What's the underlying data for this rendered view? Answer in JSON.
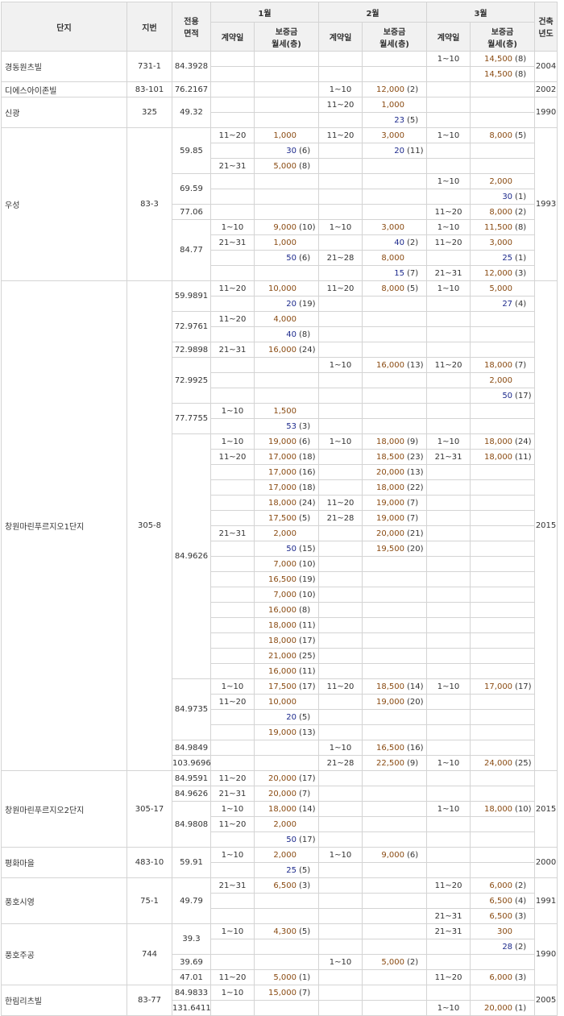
{
  "headers": {
    "complex": "단지",
    "lot": "지번",
    "area": "전용\n면적",
    "months": [
      "1월",
      "2월",
      "3월"
    ],
    "contract_day": "계약일",
    "deposit_rent": "보증금\n월세(층)",
    "built_year": "건축\n년도"
  },
  "rows": [
    {
      "name": "경동원츠빌",
      "lot": "731-1",
      "area": "84.3928",
      "m3d": "1~10",
      "m3a": "14,500",
      "m3f": "(8)",
      "year": "2004"
    },
    {
      "m3a": "14,500",
      "m3f": "(8)"
    },
    {
      "name": "디에스아이존빌",
      "lot": "83-101",
      "area": "76.2167",
      "m2d": "1~10",
      "m2a": "12,000",
      "m2f": "(2)",
      "year": "2002"
    },
    {
      "name": "신광",
      "lot": "325",
      "area": "49.32",
      "m2d": "11~20",
      "m2a": "1,000",
      "year": "1990"
    },
    {
      "m2r": "23",
      "m2f": "(5)"
    },
    {
      "name": "우성",
      "lot": "83-3",
      "area": "59.85",
      "m1d": "11~20",
      "m1a": "1,000",
      "m2d": "11~20",
      "m2a": "3,000",
      "m3d": "1~10",
      "m3a": "8,000",
      "m3f": "(5)",
      "year": "1993"
    },
    {
      "m1r": "30",
      "m1f": "(6)",
      "m2r": "20",
      "m2f": "(11)"
    },
    {
      "m1d": "21~31",
      "m1a": "5,000",
      "m1f": "(8)"
    },
    {
      "area": "69.59",
      "m3d": "1~10",
      "m3a": "2,000"
    },
    {
      "m3r": "30",
      "m3f": "(1)"
    },
    {
      "area": "77.06",
      "m3d": "11~20",
      "m3a": "8,000",
      "m3f": "(2)"
    },
    {
      "area": "84.77",
      "m1d": "1~10",
      "m1a": "9,000",
      "m1f": "(10)",
      "m2d": "1~10",
      "m2a": "3,000",
      "m3d": "1~10",
      "m3a": "11,500",
      "m3f": "(8)"
    },
    {
      "m1d": "21~31",
      "m1a": "1,000",
      "m2r": "40",
      "m2f": "(2)",
      "m3d": "11~20",
      "m3a": "3,000"
    },
    {
      "m1r": "50",
      "m1f": "(6)",
      "m2d": "21~28",
      "m2a": "8,000",
      "m3r": "25",
      "m3f": "(1)"
    },
    {
      "m2r": "15",
      "m2f": "(7)",
      "m3d": "21~31",
      "m3a": "12,000",
      "m3f": "(3)"
    },
    {
      "name": "창원마린푸르지오1단지",
      "lot": "305-8",
      "area": "59.9891",
      "m1d": "11~20",
      "m1a": "10,000",
      "m2d": "11~20",
      "m2a": "8,000",
      "m2f": "(5)",
      "m3d": "1~10",
      "m3a": "5,000",
      "year": "2015"
    },
    {
      "m1r": "20",
      "m1f": "(19)",
      "m3r": "27",
      "m3f": "(4)"
    },
    {
      "area": "72.9761",
      "m1d": "11~20",
      "m1a": "4,000"
    },
    {
      "m1r": "40",
      "m1f": "(8)"
    },
    {
      "area": "72.9898",
      "m1d": "21~31",
      "m1a": "16,000",
      "m1f": "(24)"
    },
    {
      "area": "72.9925",
      "m2d": "1~10",
      "m2a": "16,000",
      "m2f": "(13)",
      "m3d": "11~20",
      "m3a": "18,000",
      "m3f": "(7)"
    },
    {
      "m3a": "2,000"
    },
    {
      "m3r": "50",
      "m3f": "(17)"
    },
    {
      "area": "77.7755",
      "m1d": "1~10",
      "m1a": "1,500"
    },
    {
      "m1r": "53",
      "m1f": "(3)"
    },
    {
      "area": "84.9626",
      "m1d": "1~10",
      "m1a": "19,000",
      "m1f": "(6)",
      "m2d": "1~10",
      "m2a": "18,000",
      "m2f": "(9)",
      "m3d": "1~10",
      "m3a": "18,000",
      "m3f": "(24)"
    },
    {
      "m1d": "11~20",
      "m1a": "17,000",
      "m1f": "(18)",
      "m2a": "18,500",
      "m2f": "(23)",
      "m3d": "21~31",
      "m3a": "18,000",
      "m3f": "(11)"
    },
    {
      "m1a": "17,000",
      "m1f": "(16)",
      "m2a": "20,000",
      "m2f": "(13)"
    },
    {
      "m1a": "17,000",
      "m1f": "(18)",
      "m2a": "18,000",
      "m2f": "(22)"
    },
    {
      "m1a": "18,000",
      "m1f": "(24)",
      "m2d": "11~20",
      "m2a": "19,000",
      "m2f": "(7)"
    },
    {
      "m1a": "17,500",
      "m1f": "(5)",
      "m2d": "21~28",
      "m2a": "19,000",
      "m2f": "(7)"
    },
    {
      "m1d": "21~31",
      "m1a": "2,000",
      "m2a": "20,000",
      "m2f": "(21)"
    },
    {
      "m1r": "50",
      "m1f": "(15)",
      "m2a": "19,500",
      "m2f": "(20)"
    },
    {
      "m1a": "7,000",
      "m1f": "(10)"
    },
    {
      "m1a": "16,500",
      "m1f": "(19)"
    },
    {
      "m1a": "7,000",
      "m1f": "(10)"
    },
    {
      "m1a": "16,000",
      "m1f": "(8)"
    },
    {
      "m1a": "18,000",
      "m1f": "(11)"
    },
    {
      "m1a": "18,000",
      "m1f": "(17)"
    },
    {
      "m1a": "21,000",
      "m1f": "(25)"
    },
    {
      "m1a": "16,000",
      "m1f": "(11)"
    },
    {
      "area": "84.9735",
      "m1d": "1~10",
      "m1a": "17,500",
      "m1f": "(17)",
      "m2d": "11~20",
      "m2a": "18,500",
      "m2f": "(14)",
      "m3d": "1~10",
      "m3a": "17,000",
      "m3f": "(17)"
    },
    {
      "m1d": "11~20",
      "m1a": "10,000",
      "m2a": "19,000",
      "m2f": "(20)"
    },
    {
      "m1r": "20",
      "m1f": "(5)"
    },
    {
      "m1a": "19,000",
      "m1f": "(13)"
    },
    {
      "area": "84.9849",
      "m2d": "1~10",
      "m2a": "16,500",
      "m2f": "(16)"
    },
    {
      "area": "103.9696",
      "m2d": "21~28",
      "m2a": "22,500",
      "m2f": "(9)",
      "m3d": "1~10",
      "m3a": "24,000",
      "m3f": "(25)"
    },
    {
      "name": "창원마린푸르지오2단지",
      "lot": "305-17",
      "area": "84.9591",
      "m1d": "11~20",
      "m1a": "20,000",
      "m1f": "(17)",
      "year": "2015"
    },
    {
      "area": "84.9626",
      "m1d": "21~31",
      "m1a": "20,000",
      "m1f": "(7)"
    },
    {
      "area": "84.9808",
      "m1d": "1~10",
      "m1a": "18,000",
      "m1f": "(14)",
      "m3d": "1~10",
      "m3a": "18,000",
      "m3f": "(10)"
    },
    {
      "m1d": "11~20",
      "m1a": "2,000"
    },
    {
      "m1r": "50",
      "m1f": "(17)"
    },
    {
      "name": "평화마을",
      "lot": "483-10",
      "area": "59.91",
      "m1d": "1~10",
      "m1a": "2,000",
      "m2d": "1~10",
      "m2a": "9,000",
      "m2f": "(6)",
      "year": "2000"
    },
    {
      "m1r": "25",
      "m1f": "(5)"
    },
    {
      "name": "풍호시영",
      "lot": "75-1",
      "area": "49.79",
      "m1d": "21~31",
      "m1a": "6,500",
      "m1f": "(3)",
      "m3d": "11~20",
      "m3a": "6,000",
      "m3f": "(2)",
      "year": "1991"
    },
    {
      "m3a": "6,500",
      "m3f": "(4)"
    },
    {
      "m3d": "21~31",
      "m3a": "6,500",
      "m3f": "(3)"
    },
    {
      "name": "풍호주공",
      "lot": "744",
      "area": "39.3",
      "m1d": "1~10",
      "m1a": "4,300",
      "m1f": "(5)",
      "m3d": "21~31",
      "m3a": "300",
      "year": "1990"
    },
    {
      "m3r": "28",
      "m3f": "(2)"
    },
    {
      "area": "39.69",
      "m2d": "1~10",
      "m2a": "5,000",
      "m2f": "(2)"
    },
    {
      "area": "47.01",
      "m1d": "11~20",
      "m1a": "5,000",
      "m1f": "(1)",
      "m3d": "11~20",
      "m3a": "6,000",
      "m3f": "(3)"
    },
    {
      "name": "한림리츠빌",
      "lot": "83-77",
      "area": "84.9833",
      "m1d": "1~10",
      "m1a": "15,000",
      "m1f": "(7)",
      "year": "2005"
    },
    {
      "area": "131.6411",
      "m3d": "1~10",
      "m3a": "20,000",
      "m3f": "(1)"
    }
  ]
}
